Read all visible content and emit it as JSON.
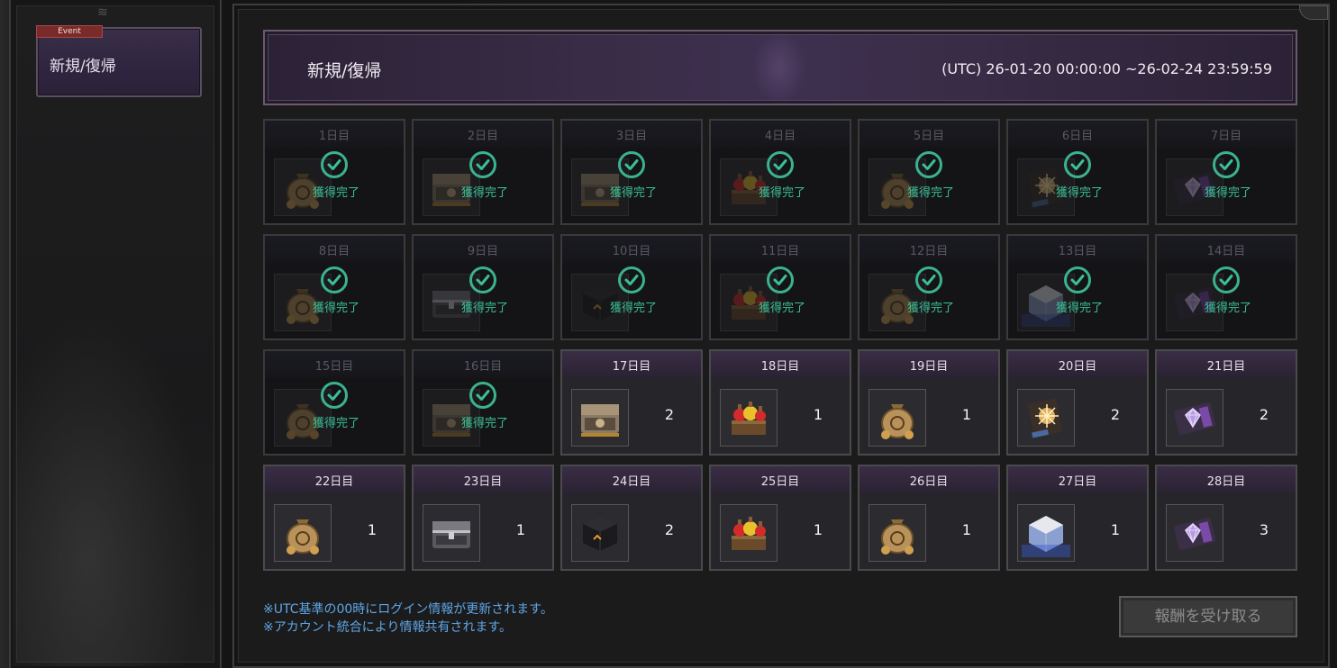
{
  "sidebar": {
    "tab_badge": "Event",
    "tab_label": "新規/復帰"
  },
  "header": {
    "title": "新規/復帰",
    "period": "(UTC) 26-01-20 00:00:00 ~26-02-24 23:59:59"
  },
  "claimed_text": "獲得完了",
  "days": [
    {
      "label": "1日目",
      "item": "coin-pouch",
      "claimed": true
    },
    {
      "label": "2日目",
      "item": "ornate-chest",
      "claimed": true
    },
    {
      "label": "3日目",
      "item": "ornate-chest",
      "claimed": true
    },
    {
      "label": "4日目",
      "item": "potion-crate",
      "claimed": true
    },
    {
      "label": "5日目",
      "item": "coin-pouch",
      "claimed": true
    },
    {
      "label": "6日目",
      "item": "rune-scroll",
      "claimed": true
    },
    {
      "label": "7日目",
      "item": "diamond-ticket",
      "claimed": true
    },
    {
      "label": "8日目",
      "item": "coin-pouch",
      "claimed": true
    },
    {
      "label": "9日目",
      "item": "iron-chest",
      "claimed": true
    },
    {
      "label": "10日目",
      "item": "black-cube",
      "claimed": true
    },
    {
      "label": "11日目",
      "item": "potion-crate",
      "claimed": true
    },
    {
      "label": "12日目",
      "item": "coin-pouch",
      "claimed": true
    },
    {
      "label": "13日目",
      "item": "silver-box",
      "claimed": true
    },
    {
      "label": "14日目",
      "item": "diamond-ticket",
      "claimed": true
    },
    {
      "label": "15日目",
      "item": "coin-pouch",
      "claimed": true
    },
    {
      "label": "16日目",
      "item": "ornate-chest",
      "claimed": true
    },
    {
      "label": "17日目",
      "item": "ornate-chest",
      "qty": "2",
      "claimed": false
    },
    {
      "label": "18日目",
      "item": "potion-crate",
      "qty": "1",
      "claimed": false
    },
    {
      "label": "19日目",
      "item": "coin-pouch",
      "qty": "1",
      "claimed": false
    },
    {
      "label": "20日目",
      "item": "rune-scroll",
      "qty": "2",
      "claimed": false
    },
    {
      "label": "21日目",
      "item": "diamond-ticket",
      "qty": "2",
      "claimed": false
    },
    {
      "label": "22日目",
      "item": "coin-pouch",
      "qty": "1",
      "claimed": false
    },
    {
      "label": "23日目",
      "item": "iron-chest",
      "qty": "1",
      "claimed": false
    },
    {
      "label": "24日目",
      "item": "black-cube",
      "qty": "2",
      "claimed": false
    },
    {
      "label": "25日目",
      "item": "potion-crate",
      "qty": "1",
      "claimed": false
    },
    {
      "label": "26日目",
      "item": "coin-pouch",
      "qty": "1",
      "claimed": false
    },
    {
      "label": "27日目",
      "item": "silver-box",
      "qty": "1",
      "claimed": false
    },
    {
      "label": "28日目",
      "item": "diamond-ticket",
      "qty": "3",
      "claimed": false
    }
  ],
  "footer": {
    "note1": "※UTC基準の00時にログイン情報が更新されます。",
    "note2": "※アカウント統合により情報共有されます。",
    "claim_button": "報酬を受け取る"
  },
  "colors": {
    "claimed_accent": "#3bbf96",
    "note_text": "#5fa6e6",
    "header_purple": "#3a2d48"
  }
}
